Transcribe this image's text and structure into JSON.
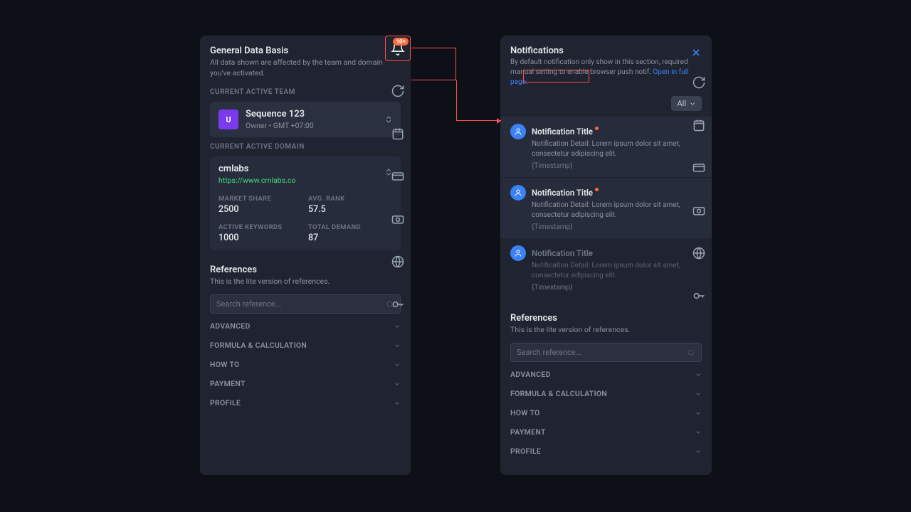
{
  "left": {
    "title": "General Data Basis",
    "subtitle": "All data shown are affected by the team and domain you've activated.",
    "team_label": "CURRENT ACTIVE TEAM",
    "team": {
      "logo": "U",
      "name": "Sequence 123",
      "meta": "Owner • GMT +07:00"
    },
    "domain_label": "CURRENT ACTIVE DOMAIN",
    "domain": {
      "name": "cmlabs",
      "url": "https://www.cmlabs.co"
    },
    "stats": {
      "market_share_l": "MARKET SHARE",
      "market_share_v": "2500",
      "avg_rank_l": "AVG. RANK",
      "avg_rank_v": "57.5",
      "active_kw_l": "ACTIVE KEYWORDS",
      "active_kw_v": "1000",
      "total_demand_l": "TOTAL DEMAND",
      "total_demand_v": "87"
    }
  },
  "refs": {
    "title": "References",
    "sub": "This is the lite version of references.",
    "placeholder": "Search reference...",
    "items": [
      "ADVANCED",
      "FORMULA & CALCULATION",
      "HOW TO",
      "PAYMENT",
      "PROFILE"
    ]
  },
  "notif": {
    "title": "Notifications",
    "desc": "By default notification only show in this section, required manual setting to enable browser push notif. ",
    "link": "Open in full page.",
    "filter": "All",
    "badge": "10+",
    "items": [
      {
        "title": "Notification Title",
        "detail": "Notification Detail: Lorem ipsum dolor sit amet, consectetur adipiscing elit.",
        "ts": "{Timestamp}",
        "unread": true
      },
      {
        "title": "Notification Title",
        "detail": "Notification Detail: Lorem ipsum dolor sit amet, consectetur adipiscing elit.",
        "ts": "{Timestamp}",
        "unread": true
      },
      {
        "title": "Notification Title",
        "detail": "Notification Detail: Lorem ipsum dolor sit amet, consectetur adipiscing elit.",
        "ts": "{Timestamp}",
        "unread": false
      }
    ]
  }
}
